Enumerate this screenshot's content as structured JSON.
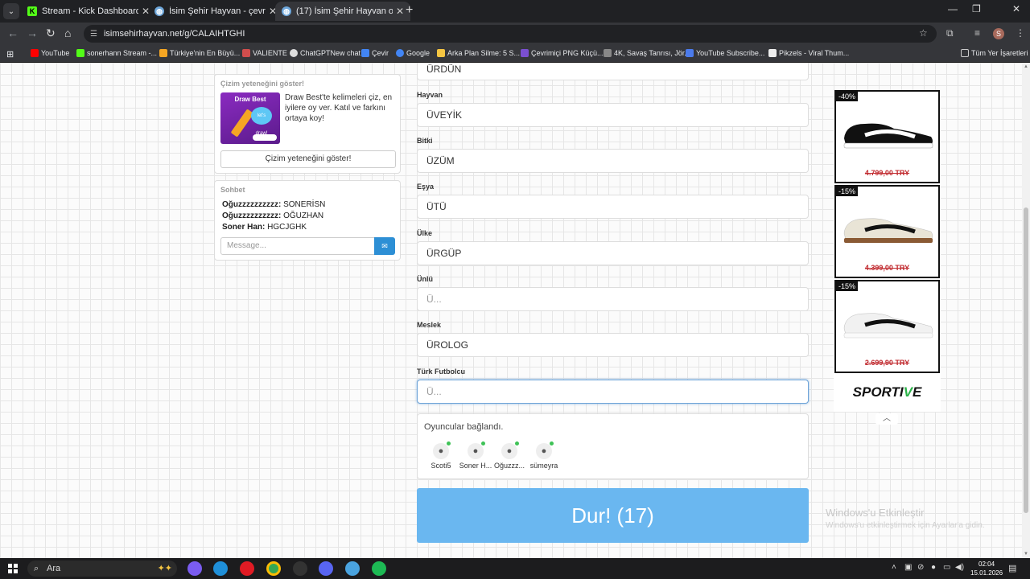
{
  "browser": {
    "tabs": [
      {
        "title": "Stream - Kick Dashboard",
        "active": false,
        "favicon": "kick-icon",
        "color": "#53fc18"
      },
      {
        "title": "İsim Şehir Hayvan - çevrimiçi oy",
        "active": false,
        "favicon": "globe-icon",
        "color": "#6fa8dc"
      },
      {
        "title": "(17) İsim Şehir Hayvan oyununa",
        "active": true,
        "favicon": "globe-icon",
        "color": "#6fa8dc"
      }
    ],
    "url": "isimsehirhayvan.net/g/CALAIHTGHI",
    "bookmarks": [
      {
        "label": "YouTube",
        "color": "#ff0000"
      },
      {
        "label": "sonerhann Stream -...",
        "color": "#53fc18"
      },
      {
        "label": "Türkiye'nin En Büyü...",
        "color": "#f5a623"
      },
      {
        "label": "VALIENTE",
        "color": "#d04d4d"
      },
      {
        "label": "ChatGPTNew chat",
        "color": "#dddddd"
      },
      {
        "label": "Çevir",
        "color": "#4285f4"
      },
      {
        "label": "Google",
        "color": "#4285f4"
      },
      {
        "label": "Arka Plan Silme: 5 S...",
        "color": "#f5c542"
      },
      {
        "label": "Çevrimiçi PNG Küçü...",
        "color": "#7a4fd0"
      },
      {
        "label": "4K, Savaş Tanrısı, Jör...",
        "color": "#888888"
      },
      {
        "label": "YouTube Subscribe...",
        "color": "#4b7bec"
      },
      {
        "label": "Pikzels - Viral Thum...",
        "color": "#eeeeee"
      }
    ],
    "all_bookmarks": "Tüm Yer İşaretleri",
    "profile_initial": "S"
  },
  "draw_panel": {
    "title": "Çizim yeteneğini göster!",
    "image_title": "Draw Best",
    "image_badge": "let's draw!",
    "description": "Draw Best'te kelimeleri çiz, en iyilere oy ver. Katıl ve farkını ortaya koy!",
    "button": "Çizim yeteneğini göster!"
  },
  "chat": {
    "title": "Sohbet",
    "messages": [
      {
        "user": "Oğuzzzzzzzzzz:",
        "text": "SONERİSN"
      },
      {
        "user": "Oğuzzzzzzzzzz:",
        "text": "OĞUZHAN"
      },
      {
        "user": "Soner Han:",
        "text": "HGCJGHK"
      }
    ],
    "placeholder": "Message..."
  },
  "form": {
    "top_value": "ÜRDÜN",
    "fields": [
      {
        "label": "Hayvan",
        "value": "ÜVEYİK",
        "placeholder": "Ü..."
      },
      {
        "label": "Bitki",
        "value": "ÜZÜM",
        "placeholder": "Ü..."
      },
      {
        "label": "Eşya",
        "value": "ÜTÜ",
        "placeholder": "Ü..."
      },
      {
        "label": "Ülke",
        "value": "ÜRGÜP",
        "placeholder": "Ü..."
      },
      {
        "label": "Ünlü",
        "value": "",
        "placeholder": "Ü..."
      },
      {
        "label": "Meslek",
        "value": "ÜROLOG",
        "placeholder": "Ü..."
      },
      {
        "label": "Türk Futbolcu",
        "value": "",
        "placeholder": "Ü..."
      }
    ]
  },
  "players": {
    "title": "Oyuncular bağlandı.",
    "list": [
      {
        "name": "Scoti5",
        "online_color": "#3fc257"
      },
      {
        "name": "Soner H...",
        "online_color": "#3fc257"
      },
      {
        "name": "Oğuzzz...",
        "online_color": "#3fc257"
      },
      {
        "name": "sümeyra",
        "online_color": "#3fc257"
      }
    ]
  },
  "stop_button": "Dur! (17)",
  "ad": {
    "items": [
      {
        "discount": "-40%",
        "price": "4.799,00 TRY",
        "shoe_color": "#111111"
      },
      {
        "discount": "-15%",
        "price": "4.399,00 TRY",
        "shoe_color": "#e9e4d6"
      },
      {
        "discount": "-15%",
        "price": "2.699,90 TRY",
        "shoe_color": "#f1f1f1"
      }
    ],
    "logo_prefix": "SPORTI",
    "logo_accent": "V",
    "logo_suffix": "E"
  },
  "watermark": {
    "line1": "Windows'u Etkinleştir",
    "line2": "Windows'u etkinleştirmek için Ayarlar'a gidin."
  },
  "taskbar": {
    "search_label": "Ara",
    "time": "02:04",
    "date": "15.01.2026"
  }
}
